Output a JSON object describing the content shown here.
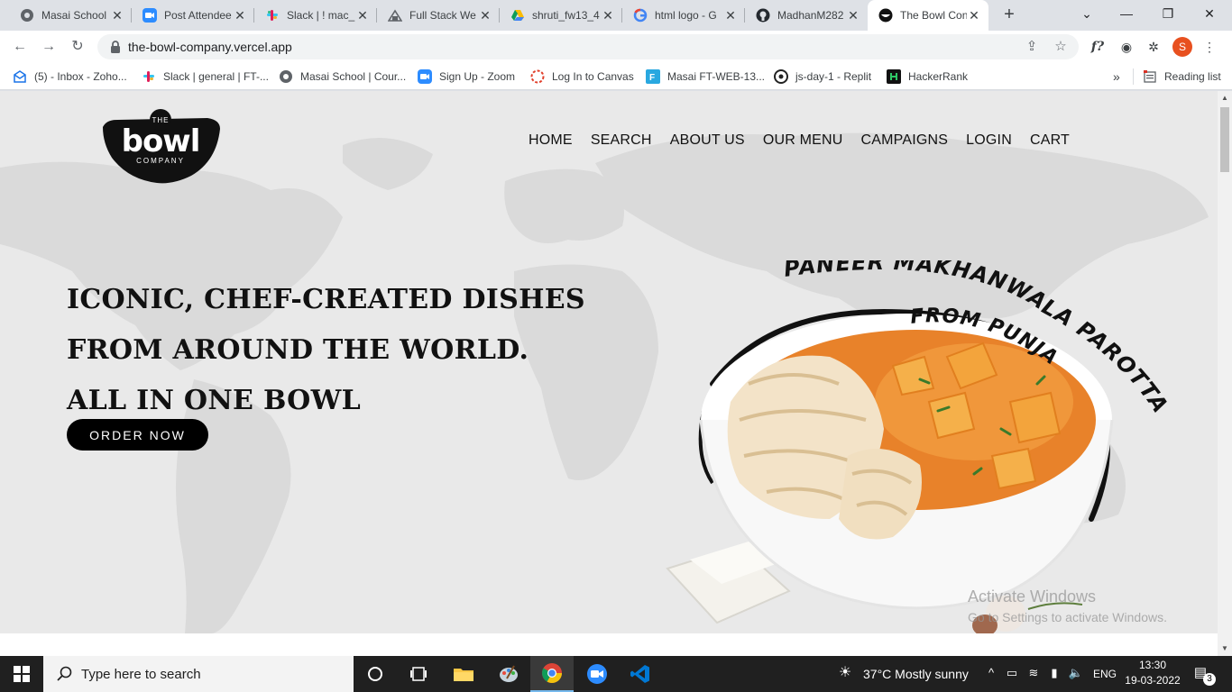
{
  "tabs": [
    {
      "title": "Masai School"
    },
    {
      "title": "Post Attendee"
    },
    {
      "title": "Slack | ! mac_"
    },
    {
      "title": "Full Stack We"
    },
    {
      "title": "shruti_fw13_4"
    },
    {
      "title": "html logo - G"
    },
    {
      "title": "MadhanM282"
    },
    {
      "title": "The Bowl Con"
    }
  ],
  "toolbar": {
    "url": "the-bowl-company.vercel.app",
    "ext_formula": "f?",
    "profile_initial": "S"
  },
  "bookmarks": [
    {
      "label": "(5) - Inbox - Zoho..."
    },
    {
      "label": "Slack | general | FT-..."
    },
    {
      "label": "Masai School | Cour..."
    },
    {
      "label": "Sign Up - Zoom"
    },
    {
      "label": "Log In to Canvas"
    },
    {
      "label": "Masai FT-WEB-13..."
    },
    {
      "label": "js-day-1 - Replit"
    },
    {
      "label": "HackerRank"
    }
  ],
  "bookmarks_more": "»",
  "reading_list": "Reading list",
  "site": {
    "logo": {
      "top": "THE",
      "main": "bowl",
      "bottom": "COMPANY"
    },
    "nav": [
      "HOME",
      "SEARCH",
      "ABOUT US",
      "OUR MENU",
      "CAMPAIGNS",
      "LOGIN",
      "CART"
    ],
    "hero_lines": [
      "ICONIC, CHEF-CREATED DISHES",
      "FROM AROUND THE WORLD.",
      "ALL IN ONE BOWL"
    ],
    "order_button": "ORDER NOW",
    "dish_title_line1": "PANEER MAKHANWALA PAROTTA BOWL",
    "dish_title_line2": "FROM PUNJAB"
  },
  "watermark": {
    "line1": "Activate Windows",
    "line2": "Go to Settings to activate Windows."
  },
  "taskbar": {
    "search_placeholder": "Type here to search",
    "weather": "37°C  Mostly sunny",
    "language": "ENG",
    "time": "13:30",
    "date": "19-03-2022",
    "notification_count": "3"
  },
  "colors": {
    "accent_blue": "#1a73e8",
    "taskbar": "#202020",
    "page_bg": "#e9e9e9",
    "curry": "#e8822a"
  }
}
